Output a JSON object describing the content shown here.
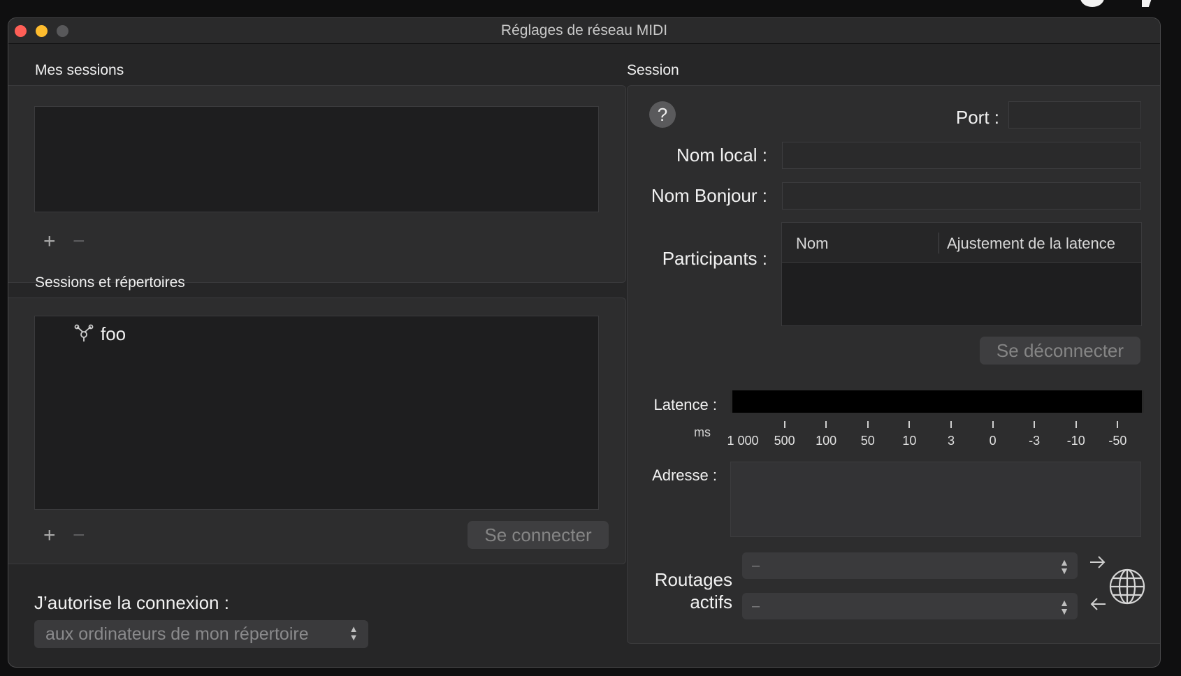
{
  "window": {
    "title": "Réglages de réseau MIDI"
  },
  "my_sessions": {
    "title": "Mes sessions",
    "add_label": "+",
    "remove_label": "−"
  },
  "directory": {
    "title": "Sessions et répertoires",
    "items": [
      {
        "label": "foo",
        "icon": "network-bonjour-icon"
      }
    ],
    "add_label": "+",
    "remove_label": "−",
    "connect_label": "Se connecter"
  },
  "allow": {
    "label": "J’autorise la connexion :",
    "selected": "aux ordinateurs de mon répertoire"
  },
  "session": {
    "title": "Session",
    "help_label": "?",
    "port_label": "Port :",
    "port_value": "",
    "local_name_label": "Nom local :",
    "local_name_value": "",
    "bonjour_name_label": "Nom Bonjour :",
    "bonjour_name_value": "",
    "participants_label": "Participants :",
    "participants_columns": [
      "Nom",
      "Ajustement de la latence"
    ],
    "disconnect_label": "Se déconnecter",
    "latency_label": "Latence :",
    "latency_unit": "ms",
    "latency_scale": [
      "1 000",
      "500",
      "100",
      "50",
      "10",
      "3",
      "0",
      "-3",
      "-10",
      "-50"
    ],
    "address_label": "Adresse :",
    "routing_label_line1": "Routages",
    "routing_label_line2": "actifs",
    "routing_out_value": "–",
    "routing_in_value": "–"
  },
  "colors": {
    "close": "#ff5f57",
    "minimize": "#febc2e",
    "zoom_inactive": "#58585a",
    "window_bg": "#262627"
  }
}
